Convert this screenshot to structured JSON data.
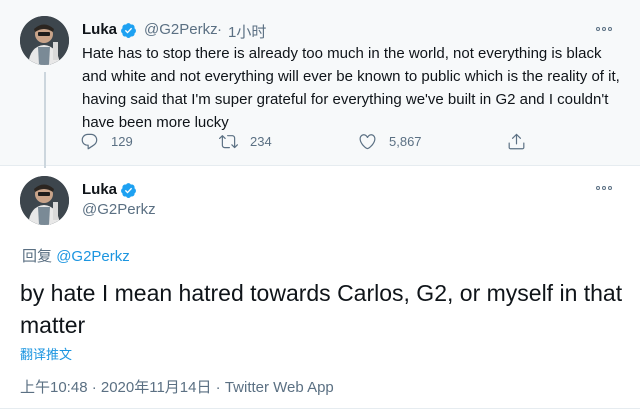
{
  "parent_tweet": {
    "display_name": "Luka",
    "handle": "@G2Perkz",
    "separator": "·",
    "time_ago": "1小时",
    "text": "Hate has to stop there is already too much in the world, not everything is black and white and not everything will ever be known to public which is the reality of it, having said that  I'm super grateful for everything we've built in G2 and I couldn't have been more lucky",
    "reply_count": "129",
    "retweet_count": "234",
    "like_count": "5,867"
  },
  "main_tweet": {
    "display_name": "Luka",
    "handle": "@G2Perkz",
    "reply_prefix": "回复",
    "reply_to": "@G2Perkz",
    "text": "by hate I mean hatred towards Carlos, G2, or myself in that matter",
    "translate_label": "翻译推文",
    "timestamp": "上午10:48 · 2020年11月14日 · Twitter Web App"
  },
  "icons": {
    "verified": "verified-badge-icon",
    "more": "more-options-icon",
    "reply": "reply-icon",
    "retweet": "retweet-icon",
    "like": "heart-icon",
    "share": "share-icon"
  },
  "colors": {
    "accent": "#1b95e0",
    "muted": "#5b7083",
    "text": "#0f1419"
  }
}
